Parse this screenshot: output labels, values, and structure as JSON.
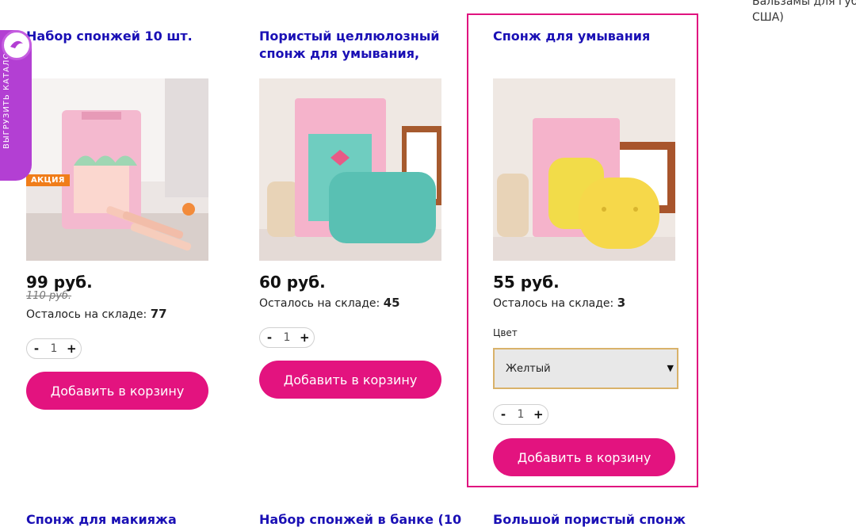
{
  "side_text": {
    "line1": "Бальзамы для губ (",
    "line2": "США)"
  },
  "catalog_tab": {
    "label": "ВЫГРУЗИТЬ КАТАЛОГ"
  },
  "products": [
    {
      "title": "Набор спонжей 10 шт.",
      "badge": "АКЦИЯ",
      "price": "99 руб.",
      "old_price": "110 руб.",
      "stock_label": "Осталось на складе:",
      "stock_value": "77",
      "qty": "1",
      "minus": "-",
      "plus": "+",
      "cart_label": "Добавить в корзину"
    },
    {
      "title": "Пористый целлюлозный спонж для умывания,",
      "price": "60 руб.",
      "stock_label": "Осталось на складе:",
      "stock_value": "45",
      "qty": "1",
      "minus": "-",
      "plus": "+",
      "cart_label": "Добавить в корзину"
    },
    {
      "title": "Спонж для умывания",
      "price": "55 руб.",
      "stock_label": "Осталось на складе:",
      "stock_value": "3",
      "color_label": "Цвет",
      "color_value": "Желтый",
      "qty": "1",
      "minus": "-",
      "plus": "+",
      "cart_label": "Добавить в корзину"
    }
  ],
  "next_row_titles": [
    "Спонж для макияжа",
    "Набор спонжей в банке (10",
    "Большой пористый спонж"
  ],
  "colors": {
    "title": "#1a10b5",
    "accent": "#e3137f",
    "catalog": "#b33fd3",
    "badge": "#f07d1a"
  }
}
